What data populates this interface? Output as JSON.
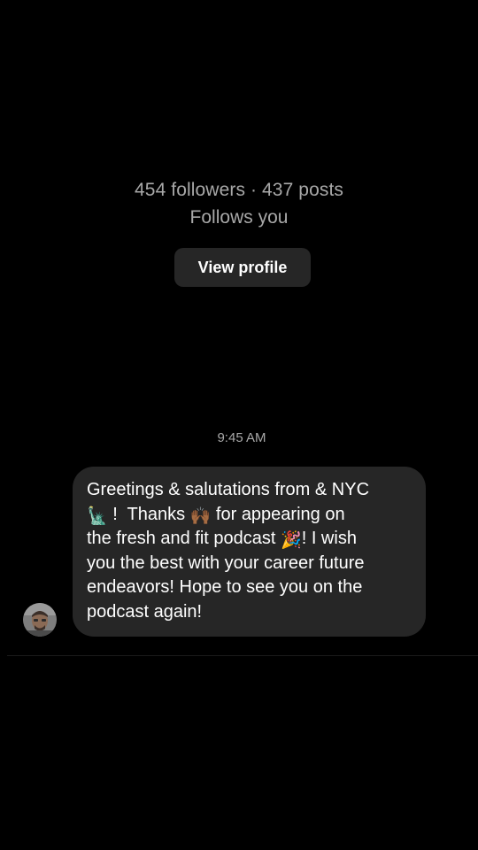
{
  "profile": {
    "stats": "454 followers · 437 posts",
    "follow_status": "Follows you",
    "view_profile_label": "View profile"
  },
  "conversation": {
    "timestamp": "9:45 AM",
    "message": {
      "lines": [
        [
          "Greetings & salutations from &  NYC"
        ],
        [
          "",
          "statue-of-liberty-emoji",
          " !  Thanks ",
          "raising-hands-emoji",
          " for appearing on"
        ],
        [
          "the fresh and fit podcast ",
          "party-popper-emoji",
          "! I wish"
        ],
        [
          "you the best with your career future"
        ],
        [
          "endeavors! Hope to see you on the"
        ],
        [
          "podcast again!"
        ]
      ],
      "line_1": "Greetings & salutations from &  NYC",
      "line_2_a": " !  Thanks ",
      "line_2_b": " for appearing on",
      "line_3_a": "the fresh and fit podcast ",
      "line_3_b": "! I wish",
      "line_4": "you the best with your career future",
      "line_5": "endeavors! Hope to see you on the",
      "line_6": "podcast again!"
    },
    "emojis": {
      "statue_of_liberty": "🗽",
      "raising_hands": "🙌🏾",
      "party_popper": "🎉"
    },
    "sender_avatar_icon": "avatar-photo"
  },
  "colors": {
    "background": "#000000",
    "bubble": "#262626",
    "secondary_text": "#a8a8a8",
    "primary_text": "#ffffff"
  }
}
